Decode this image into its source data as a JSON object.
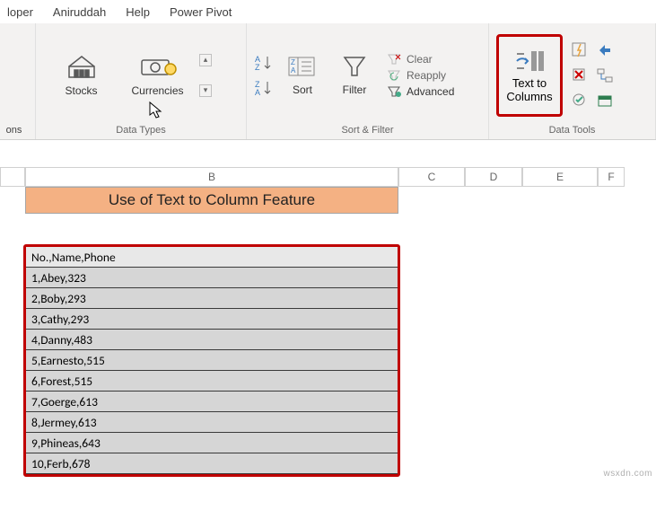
{
  "menu": {
    "items": [
      "loper",
      "Aniruddah",
      "Help",
      "Power Pivot"
    ]
  },
  "ribbon": {
    "addons_label": "ons",
    "datatypes": {
      "stocks": "Stocks",
      "currencies": "Currencies",
      "group_label": "Data Types"
    },
    "sortfilter": {
      "sort": "Sort",
      "filter": "Filter",
      "clear": "Clear",
      "reapply": "Reapply",
      "advanced": "Advanced",
      "group_label": "Sort & Filter"
    },
    "datatools": {
      "text_to_columns_l1": "Text to",
      "text_to_columns_l2": "Columns",
      "group_label": "Data Tools"
    }
  },
  "sheet": {
    "columns": [
      "B",
      "C",
      "D",
      "E",
      "F"
    ],
    "title": "Use of Text to Column Feature",
    "rows": [
      "No.,Name,Phone",
      "1,Abey,323",
      "2,Boby,293",
      "3,Cathy,293",
      "4,Danny,483",
      "5,Earnesto,515",
      "6,Forest,515",
      "7,Goerge,613",
      "8,Jermey,613",
      "9,Phineas,643",
      "10,Ferb,678"
    ]
  },
  "watermark": "wsxdn.com"
}
